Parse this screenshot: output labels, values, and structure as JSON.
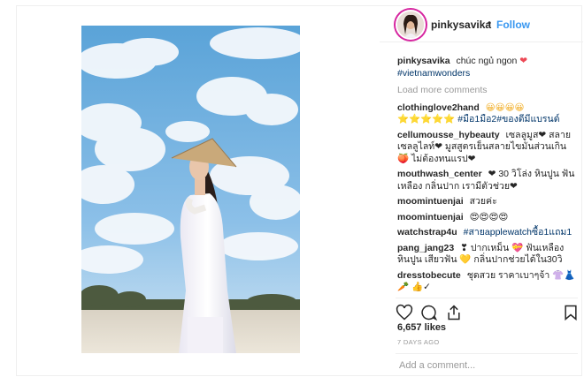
{
  "post": {
    "username": "pinkysavika",
    "follow_label": "Follow",
    "separator": "•",
    "caption_text": "chúc ngủ ngon",
    "caption_emoji": "❤",
    "caption_tag": "#vietnamwonders",
    "load_more": "Load more comments",
    "likes": "6,657 likes",
    "date": "7 DAYS AGO",
    "add_comment_placeholder": "Add a comment..."
  },
  "comments": [
    {
      "user": "clothinglove2hand",
      "text": "😀😀😀😀"
    },
    {
      "user": "",
      "text": "⭐⭐⭐⭐⭐ #มือ1มือ2#ของดีมีแบรนด์"
    },
    {
      "user": "cellumousse_hybeauty",
      "text": "เซลลูมูส❤ สลาย เซลลูไลท์❤ มูสสูตรเย็นสลายไขมันส่วนเกิน🍑 ไม่ต้องทนแรป❤"
    },
    {
      "user": "mouthwash_center",
      "text": "❤ 30 วิโล่ง หินปูน ฟันเหลือง กลิ่นปาก เรามีตัวช่วย❤"
    },
    {
      "user": "moomintuenjai",
      "text": "สวยค่ะ"
    },
    {
      "user": "moomintuenjai",
      "text": "😍😍😍😍"
    },
    {
      "user": "watchstrap4u",
      "text": "#สายapplewatchซื้อ1แถม1"
    },
    {
      "user": "pang_jang23",
      "text": "❣ ปากเหม็น 💝 ฟันเหลือง หินปูน เสียวฟัน 💛 กลิ่นปากช่วยได้ใน30วิ"
    },
    {
      "user": "dresstobecute",
      "text": "ชุดสวย ราคาเบาๆจ้า 👚👗🥕 👍✓"
    }
  ],
  "icons": {
    "avatar": "profile-photo",
    "like": "heart-outline-icon",
    "comment": "comment-bubble-icon",
    "share": "share-icon",
    "save": "bookmark-icon"
  },
  "colors": {
    "link": "#3897f0",
    "hashtag": "#003569",
    "meta_text": "#999999",
    "border": "#efefef"
  }
}
